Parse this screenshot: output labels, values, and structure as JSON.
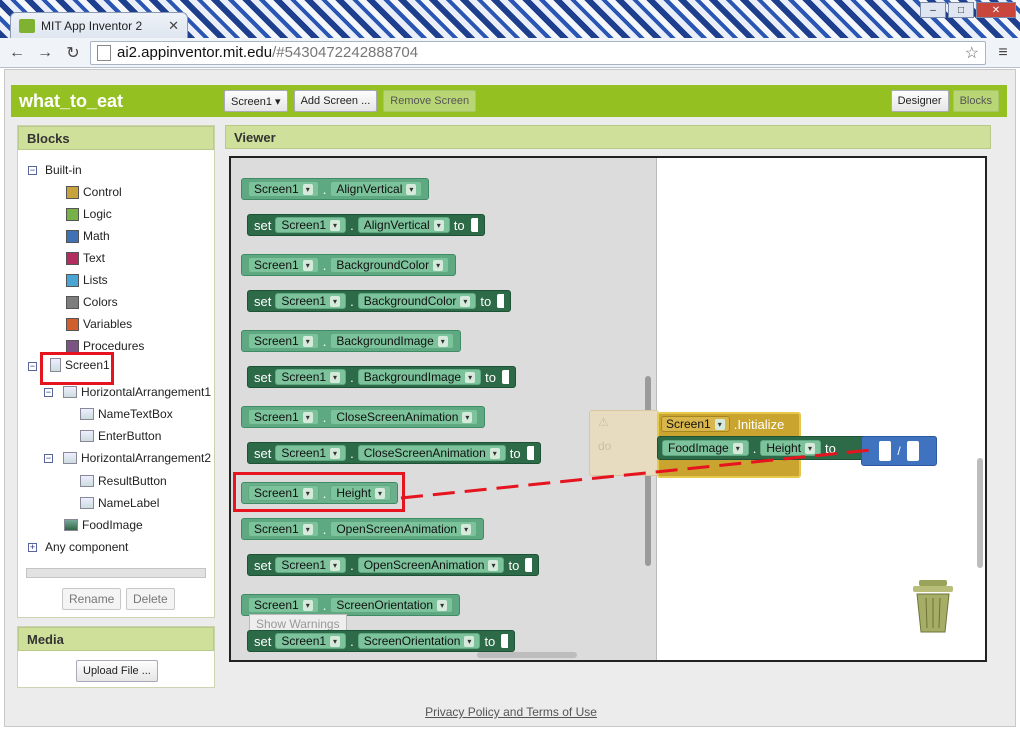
{
  "browser": {
    "tab_title": "MIT App Inventor 2",
    "url_host": "ai2.appinventor.mit.edu",
    "url_path": "/#5430472242888704"
  },
  "header": {
    "project_name": "what_to_eat",
    "screen_select": "Screen1 ▾",
    "add_screen": "Add Screen ...",
    "remove_screen": "Remove Screen",
    "designer": "Designer",
    "blocks": "Blocks"
  },
  "blocks_panel": {
    "title": "Blocks",
    "builtin_label": "Built-in",
    "builtin": [
      {
        "label": "Control",
        "color": "#c7a33b"
      },
      {
        "label": "Logic",
        "color": "#77b149"
      },
      {
        "label": "Math",
        "color": "#3f71b5"
      },
      {
        "label": "Text",
        "color": "#b32d5e"
      },
      {
        "label": "Lists",
        "color": "#49a6d4"
      },
      {
        "label": "Colors",
        "color": "#7d7d7d"
      },
      {
        "label": "Variables",
        "color": "#d05f2d"
      },
      {
        "label": "Procedures",
        "color": "#7c5385"
      }
    ],
    "components": {
      "screen": "Screen1",
      "ha1": "HorizontalArrangement1",
      "name_textbox": "NameTextBox",
      "enter_button": "EnterButton",
      "ha2": "HorizontalArrangement2",
      "result_button": "ResultButton",
      "name_label": "NameLabel",
      "food_image": "FoodImage"
    },
    "any_component": "Any component",
    "rename": "Rename",
    "delete": "Delete"
  },
  "media_panel": {
    "title": "Media",
    "upload": "Upload File ..."
  },
  "viewer": {
    "title": "Viewer",
    "component": "Screen1",
    "set_label": "set",
    "to_label": "to",
    "properties": [
      "AlignVertical",
      "BackgroundColor",
      "BackgroundImage",
      "CloseScreenAnimation",
      "Height",
      "OpenScreenAnimation",
      "ScreenOrientation"
    ],
    "show_warnings": "Show Warnings",
    "event_component": "Screen1",
    "event_name": ".Initialize",
    "do_label": "do",
    "target_component": "FoodImage",
    "target_property": "Height",
    "math_op": "/"
  },
  "footer": {
    "link": "Privacy Policy and Terms of Use"
  },
  "colors": {
    "highlight": "#e6141e",
    "brand": "#95c022"
  }
}
